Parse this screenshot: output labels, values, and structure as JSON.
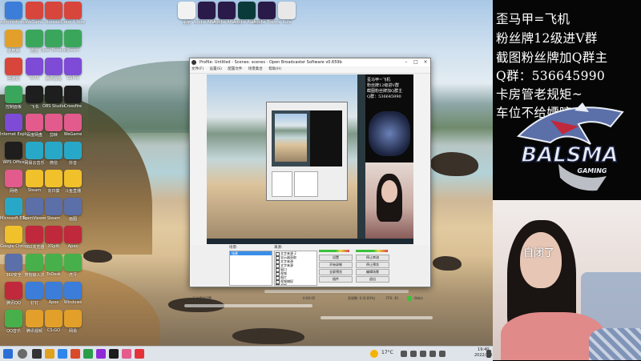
{
  "desktop": {
    "icons_col1": [
      "Administrator",
      "此电脑",
      "回收站",
      "控制面板",
      "Internet Explorer",
      "WPS Office",
      "网络",
      "Microsoft Edge",
      "Google Chrome",
      "360安全",
      "腾讯QQ",
      "QQ音乐"
    ],
    "icons_col2": [
      "WeGame",
      "迅雷",
      "WPS",
      "飞书",
      "百度网盘",
      "网易云音乐",
      "Steam",
      "TeamViewer",
      "360浏览器",
      "搜狗输入法",
      "钉钉",
      "腾讯视频"
    ],
    "icons_col3": [
      "Netease",
      "Open Broadcaster",
      "腾讯会议",
      "OBS Studio",
      "剪映",
      "微信",
      "向日葵",
      "Steam",
      "XSplit",
      "ToDesk",
      "Apex",
      "CS:GO"
    ],
    "icons_col4": [
      "Draw it Now",
      "Steam",
      "GoPro",
      "Crossfire",
      "WeGame",
      "抖音",
      "斗鱼直播",
      "画图",
      "Apex",
      "虎牙",
      "Windows",
      "网易"
    ],
    "icons_top": [
      "手册",
      "Adobe After Effects",
      "Adobe After Effects",
      "Adobe Audition",
      "Adobe Premiere",
      "Rule"
    ]
  },
  "obs": {
    "title": "Profile: Untitled - Scenes: scenes - Open Broadcaster Software v0.659b",
    "menu": [
      "文件(F)",
      "设置(S)",
      "配置文件",
      "场景集合",
      "帮助(H)"
    ],
    "scenes_label": "场景:",
    "sources_label": "来源:",
    "scene_selected": "场景",
    "sources": [
      "文字来源 2",
      "显示器获取",
      "文字来源",
      "文字来源",
      "窗口",
      "视频",
      "图片",
      "视频捕捉",
      "视频"
    ],
    "buttons": [
      "设置",
      "停止串流",
      "开始录制",
      "停止预览",
      "全屏预览",
      "编辑场景",
      "插件",
      "退出"
    ],
    "status_left": "无法预览设置",
    "status_time": "0:00:05",
    "status_drop": "丢帧数: 0 (0.00%)",
    "status_fps": "FPS: 30",
    "status_kbps": "0kb/s"
  },
  "taskbar": {
    "temperature": "17°C",
    "time": "19:40",
    "date": "2022/2/8"
  },
  "overlay": {
    "lines": [
      "歪马甲=飞机",
      "粉丝牌12级进V群",
      "截图粉丝牌加Q群主",
      "Q群：536645990",
      "卡房管老规矩~",
      "车位不给嫖哼"
    ],
    "logo_text": "BALSMA",
    "logo_sub": "GAMING",
    "cam_caption": "自闭了"
  },
  "colors": {
    "overlay_bg": "#060606",
    "logo_blue": "#5b6fa8",
    "logo_red": "#c0283c",
    "taskbar": "#dfe4ea"
  }
}
